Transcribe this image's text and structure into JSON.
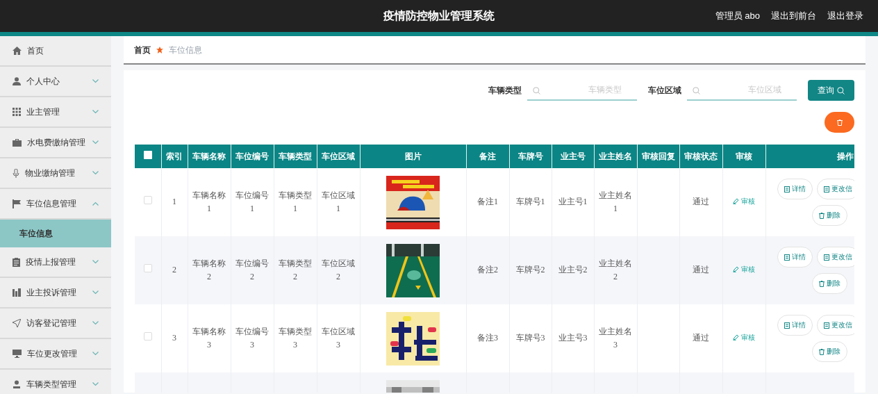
{
  "header": {
    "title": "疫情防控物业管理系统",
    "user": "管理员 abo",
    "links": [
      "退出到前台",
      "退出登录"
    ]
  },
  "sidebar": {
    "items": [
      {
        "label": "首页"
      },
      {
        "label": "个人中心",
        "expanded": false
      },
      {
        "label": "业主管理",
        "expanded": false
      },
      {
        "label": "水电费缴纳管理",
        "expanded": false
      },
      {
        "label": "物业缴纳管理",
        "expanded": false
      },
      {
        "label": "车位信息管理",
        "expanded": true,
        "children": [
          {
            "label": "车位信息",
            "selected": true
          }
        ]
      },
      {
        "label": "疫情上报管理",
        "expanded": false
      },
      {
        "label": "业主投诉管理",
        "expanded": false
      },
      {
        "label": "访客登记管理",
        "expanded": false
      },
      {
        "label": "车位更改管理",
        "expanded": false
      },
      {
        "label": "车辆类型管理",
        "expanded": false
      }
    ]
  },
  "breadcrumb": [
    {
      "label": "首页",
      "current": false
    },
    {
      "label": "车位信息",
      "current": true
    }
  ],
  "filters": [
    {
      "label": "车辆类型",
      "placeholder": "车辆类型"
    },
    {
      "label": "车位区域",
      "placeholder": "车位区域"
    }
  ],
  "search_button": "查询",
  "table": {
    "header_checked": false,
    "columns": [
      "索引",
      "车辆名称",
      "车位编号",
      "车辆类型",
      "车位区域",
      "图片",
      "备注",
      "车牌号",
      "业主号",
      "业主姓名",
      "审核回复",
      "审核状态",
      "审核",
      "操作"
    ],
    "rows": [
      {
        "selected": false,
        "index": "1",
        "name": "车辆名称1",
        "slot_no": "车位编号1",
        "vehicle_type": "车辆类型1",
        "area": "车位区域1",
        "image": {
          "kind": "picture"
        },
        "remark": "备注1",
        "plate": "车牌号1",
        "owner_no": "业主号1",
        "owner_name": "业主姓名1",
        "review_status": "通过",
        "review_action": "审核",
        "actions": [
          "详情",
          "更改信",
          "删除"
        ]
      },
      {
        "selected": false,
        "index": "2",
        "name": "车辆名称2",
        "slot_no": "车位编号2",
        "vehicle_type": "车辆类型2",
        "area": "车位区域2",
        "image": {
          "kind": "picture"
        },
        "remark": "备注2",
        "plate": "车牌号2",
        "owner_no": "业主号2",
        "owner_name": "业主姓名2",
        "review_status": "通过",
        "review_action": "审核",
        "actions": [
          "详情",
          "更改信",
          "删除"
        ]
      },
      {
        "selected": false,
        "index": "3",
        "name": "车辆名称3",
        "slot_no": "车位编号3",
        "vehicle_type": "车辆类型3",
        "area": "车位区域3",
        "image": {
          "kind": "picture"
        },
        "remark": "备注3",
        "plate": "车牌号3",
        "owner_no": "业主号3",
        "owner_name": "业主姓名3",
        "review_status": "通过",
        "review_action": "审核",
        "actions": [
          "详情",
          "更改信",
          "删除"
        ]
      },
      {
        "image": {
          "kind": "picture"
        }
      }
    ]
  }
}
